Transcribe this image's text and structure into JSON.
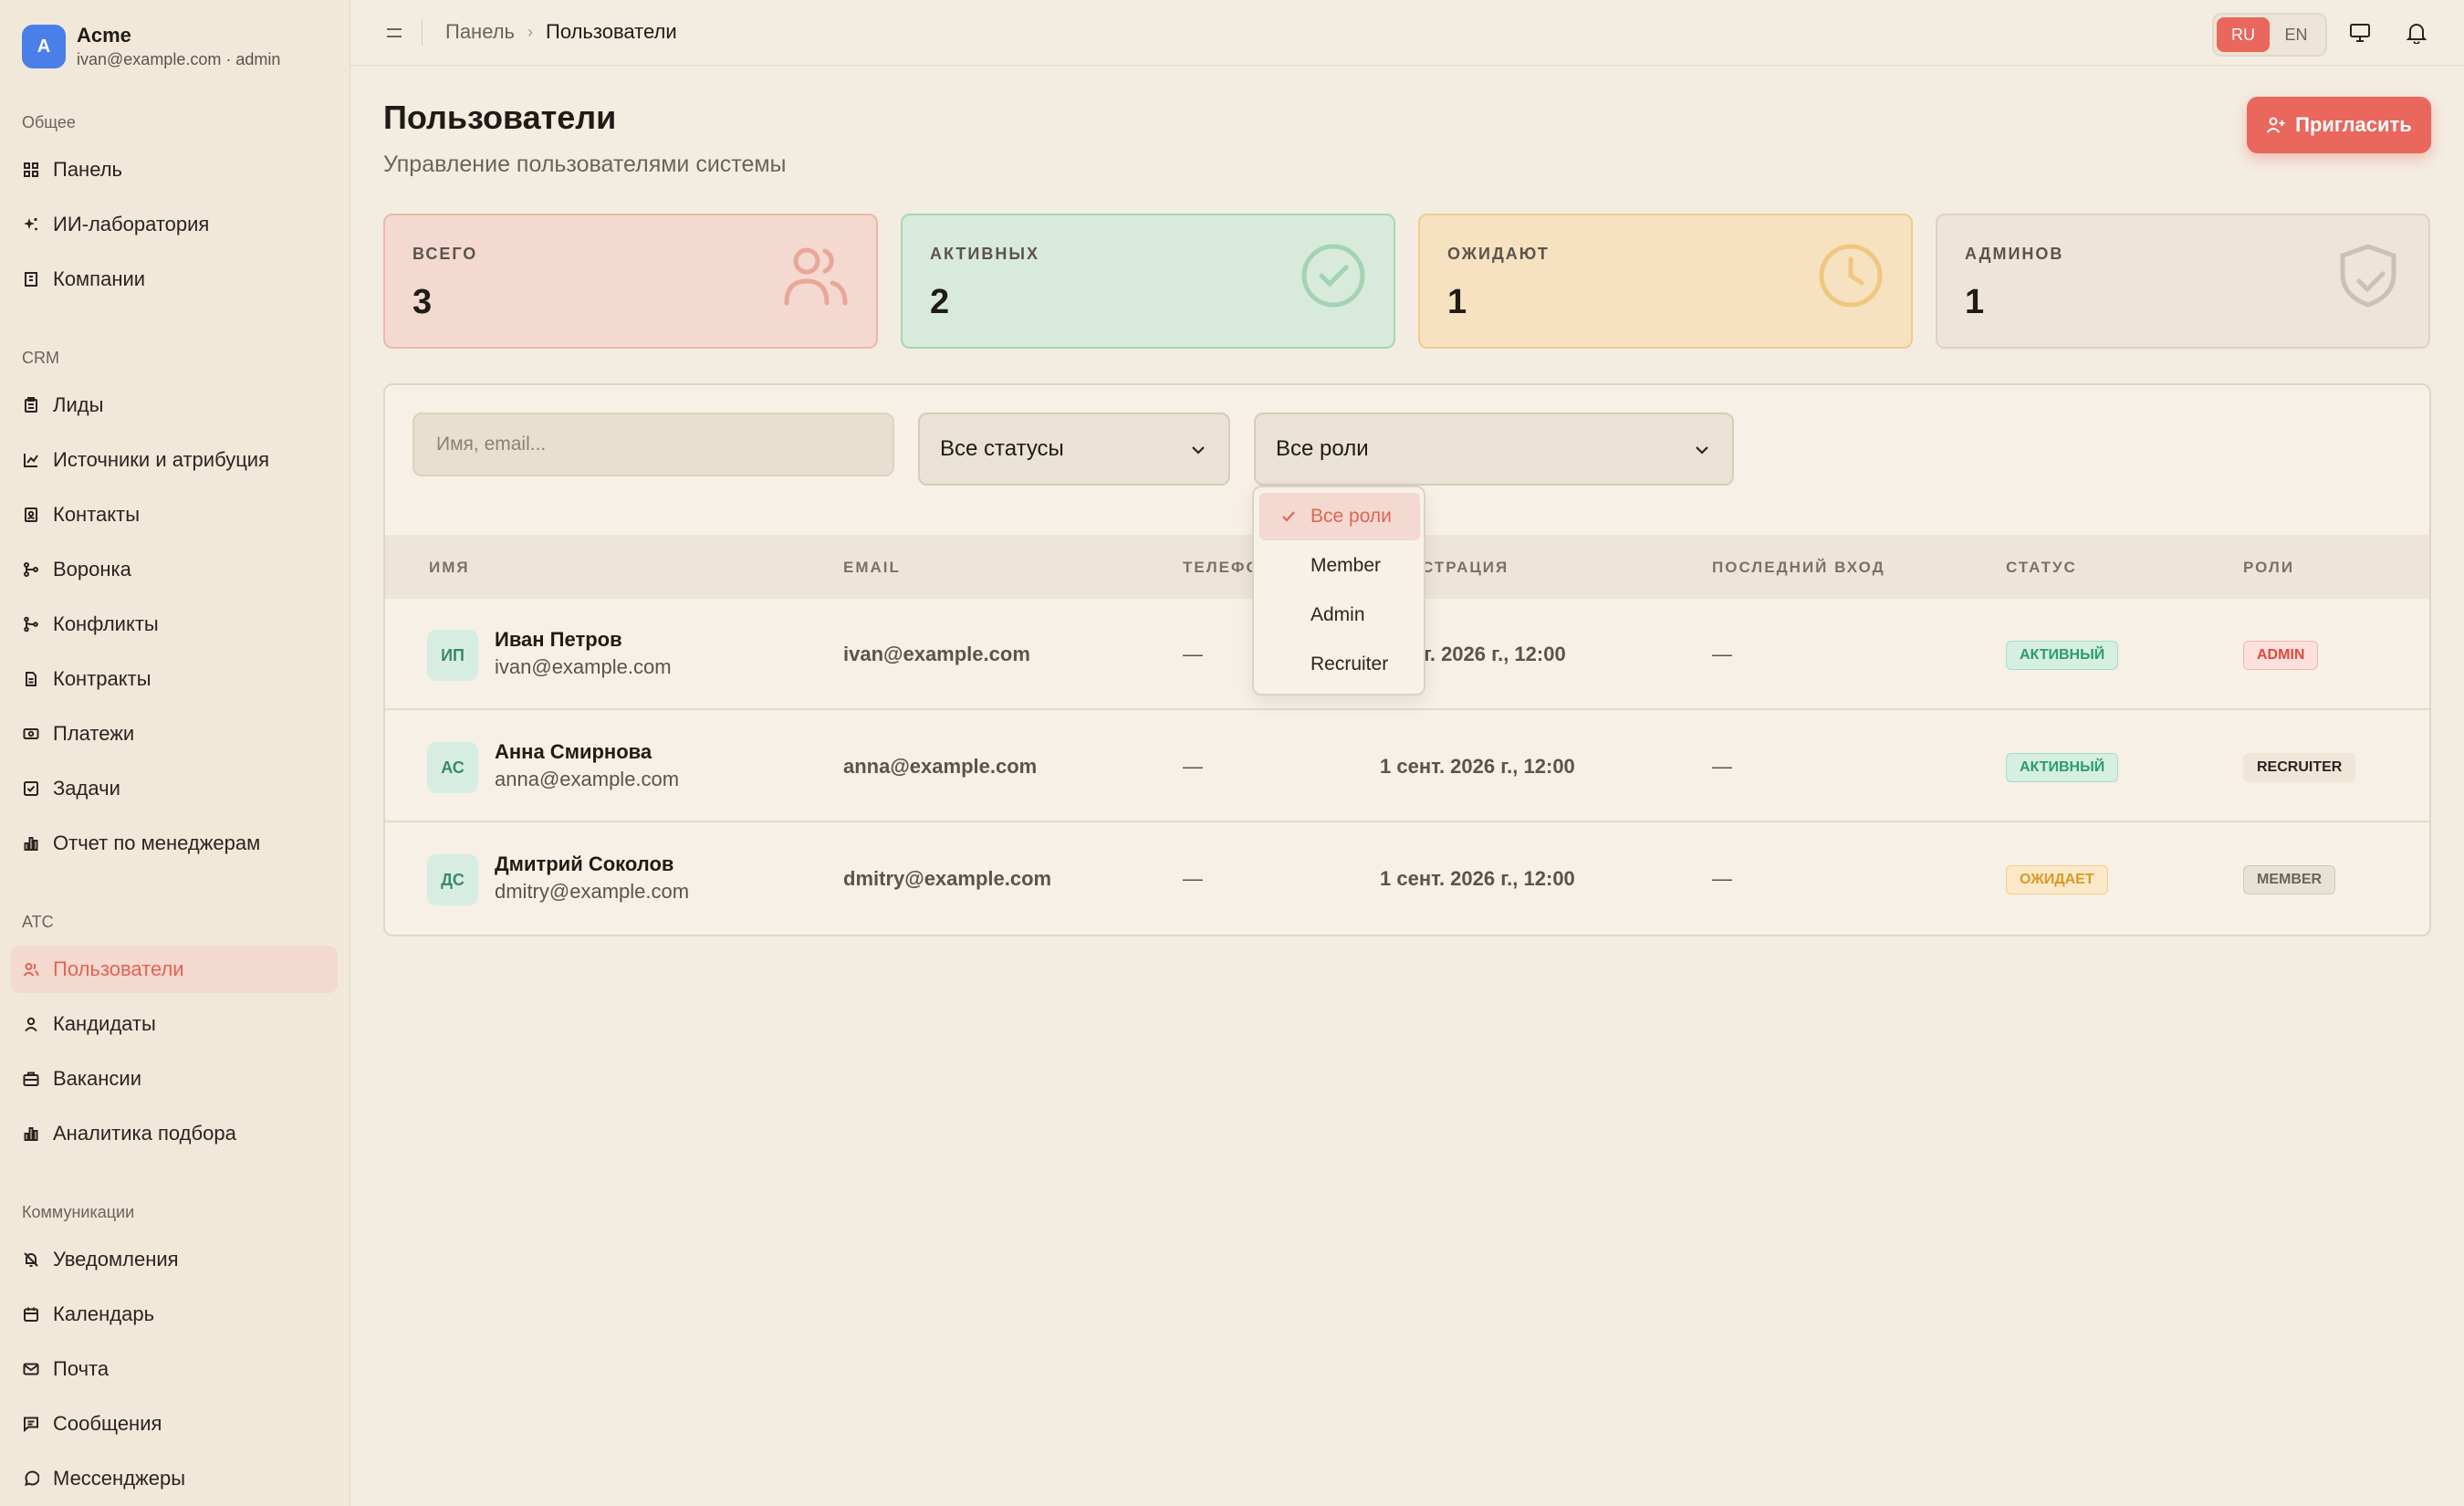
{
  "brand": {
    "logo": "A",
    "name": "Acme",
    "sub": "ivan@example.com · admin"
  },
  "sidebar": {
    "sections": [
      {
        "title": "Общее",
        "items": [
          {
            "label": "Панель",
            "icon": "grid-icon"
          },
          {
            "label": "ИИ-лаборатория",
            "icon": "sparkles-icon"
          },
          {
            "label": "Компании",
            "icon": "building-icon"
          }
        ]
      },
      {
        "title": "CRM",
        "items": [
          {
            "label": "Лиды",
            "icon": "clipboard-icon"
          },
          {
            "label": "Источники и атрибуция",
            "icon": "chart-line-icon"
          },
          {
            "label": "Контакты",
            "icon": "contact-book-icon"
          },
          {
            "label": "Воронка",
            "icon": "funnel-icon"
          },
          {
            "label": "Конфликты",
            "icon": "git-merge-icon"
          },
          {
            "label": "Контракты",
            "icon": "document-icon"
          },
          {
            "label": "Платежи",
            "icon": "banknote-icon"
          },
          {
            "label": "Задачи",
            "icon": "checkbox-icon"
          },
          {
            "label": "Отчет по менеджерам",
            "icon": "bar-chart-icon"
          }
        ]
      },
      {
        "title": "ATC",
        "items": [
          {
            "label": "Пользователи",
            "icon": "users-icon",
            "active": true
          },
          {
            "label": "Кандидаты",
            "icon": "user-icon"
          },
          {
            "label": "Вакансии",
            "icon": "briefcase-icon"
          },
          {
            "label": "Аналитика подбора",
            "icon": "bar-chart-icon"
          }
        ]
      },
      {
        "title": "Коммуникации",
        "items": [
          {
            "label": "Уведомления",
            "icon": "bell-off-icon"
          },
          {
            "label": "Календарь",
            "icon": "calendar-icon"
          },
          {
            "label": "Почта",
            "icon": "mail-icon"
          },
          {
            "label": "Сообщения",
            "icon": "message-square-icon"
          },
          {
            "label": "Мессенджеры",
            "icon": "message-circle-icon"
          }
        ]
      }
    ]
  },
  "topbar": {
    "breadcrumb": {
      "home": "Панель",
      "current": "Пользователи"
    },
    "lang": {
      "ru": "RU",
      "en": "EN",
      "active": "RU"
    }
  },
  "header": {
    "title": "Пользователи",
    "subtitle": "Управление пользователями системы",
    "invite_label": "Пригласить"
  },
  "stats": [
    {
      "label": "ВСЕГО",
      "value": "3",
      "icon": "users-icon",
      "bg": "#f3d9cf",
      "border": "#ecb8aa",
      "icon_color": "#e9a797"
    },
    {
      "label": "АКТИВНЫХ",
      "value": "2",
      "icon": "check-circle-icon",
      "bg": "#d8eadb",
      "border": "#a9d5b6",
      "icon_color": "#a3d3b5"
    },
    {
      "label": "ОЖИДАЮТ",
      "value": "1",
      "icon": "clock-icon",
      "bg": "#f6e2c0",
      "border": "#efcb8a",
      "icon_color": "#efc77f"
    },
    {
      "label": "АДМИНОВ",
      "value": "1",
      "icon": "shield-check-icon",
      "bg": "#ede5d8",
      "border": "#ddd2c1",
      "icon_color": "#cbc2b5"
    }
  ],
  "filters": {
    "search_placeholder": "Имя, email...",
    "status_value": "Все статусы",
    "role_value": "Все роли"
  },
  "table": {
    "columns": [
      "ИМЯ",
      "EMAIL",
      "ТЕЛЕФО",
      "СТРАЦИЯ",
      "ПОСЛЕДНИЙ ВХОД",
      "СТАТУС",
      "РОЛИ"
    ],
    "rows": [
      {
        "initials": "ИП",
        "name": "Иван Петров",
        "sub": "ivan@example.com",
        "email": "ivan@example.com",
        "phone": "—",
        "registered": "т. 2026 г., 12:00",
        "last_login": "—",
        "status": "АКТИВНЫЙ",
        "status_kind": "active",
        "role": "ADMIN",
        "role_kind": "admin"
      },
      {
        "initials": "АС",
        "name": "Анна Смирнова",
        "sub": "anna@example.com",
        "email": "anna@example.com",
        "phone": "—",
        "registered": "1 сент. 2026 г., 12:00",
        "last_login": "—",
        "status": "АКТИВНЫЙ",
        "status_kind": "active",
        "role": "RECRUITER",
        "role_kind": "recruiter"
      },
      {
        "initials": "ДС",
        "name": "Дмитрий Соколов",
        "sub": "dmitry@example.com",
        "email": "dmitry@example.com",
        "phone": "—",
        "registered": "1 сент. 2026 г., 12:00",
        "last_login": "—",
        "status": "ОЖИДАЕТ",
        "status_kind": "pending",
        "role": "MEMBER",
        "role_kind": "member"
      }
    ]
  },
  "role_dropdown": {
    "options": [
      "Все роли",
      "Member",
      "Admin",
      "Recruiter"
    ],
    "selected": "Все роли"
  }
}
